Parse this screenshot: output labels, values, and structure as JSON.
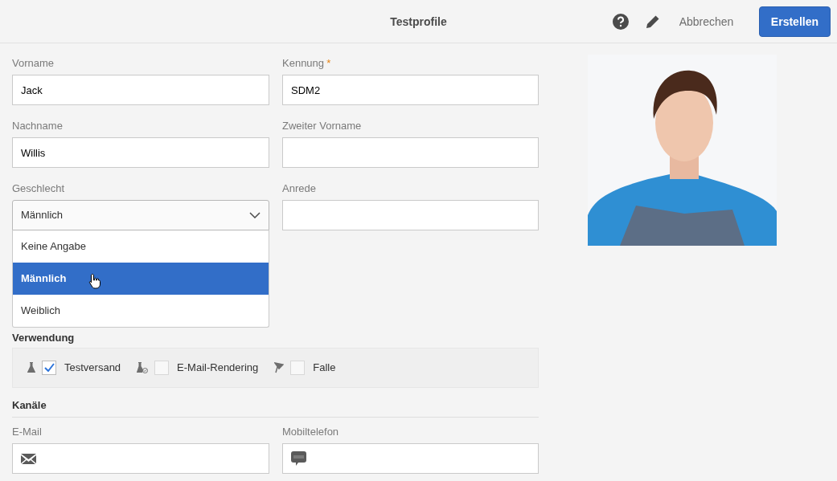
{
  "header": {
    "title": "Testprofile",
    "cancel": "Abbrechen",
    "create": "Erstellen"
  },
  "fields": [
    {
      "label": "Vorname",
      "value": "Jack",
      "kind": "text"
    },
    {
      "label": "Kennung",
      "required_mark": "*",
      "value": "SDM2",
      "kind": "text"
    },
    {
      "label": "Nachname",
      "value": "Willis",
      "kind": "text"
    },
    {
      "label": "Zweiter Vorname",
      "kind": "text"
    },
    {
      "label": "Geschlecht",
      "value": "Männlich",
      "kind": "select",
      "expanded": true,
      "options": [
        {
          "label": "Keine Angabe",
          "selected": false
        },
        {
          "label": "Männlich",
          "selected": true
        },
        {
          "label": "Weiblich",
          "selected": false
        }
      ]
    },
    {
      "label": "Anrede",
      "kind": "text"
    }
  ],
  "usage": {
    "heading": "Verwendung",
    "options": [
      {
        "label": "Testversand",
        "checked": true,
        "kind": "test"
      },
      {
        "label": "E-Mail-Rendering",
        "checked": false,
        "kind": "rendering"
      },
      {
        "label": "Falle",
        "checked": false,
        "kind": "trap"
      }
    ]
  },
  "channels": {
    "heading": "Kanäle",
    "fields": [
      {
        "label": "E-Mail",
        "kind": "email"
      },
      {
        "label": "Mobiltelefon",
        "kind": "sms"
      }
    ]
  }
}
